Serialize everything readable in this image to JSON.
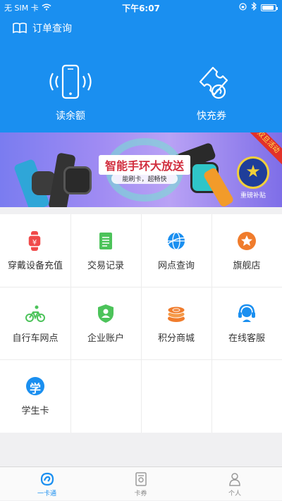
{
  "status_bar": {
    "carrier": "无 SIM 卡",
    "time": "下午6:07",
    "battery_level": 0.9
  },
  "header": {
    "order_query_label": "订单查询",
    "order_query_icon": "book-icon",
    "read_balance_label": "读余额",
    "read_balance_icon": "phone-nfc-icon",
    "quick_recharge_label": "快充券",
    "quick_recharge_icon": "ticket-icon"
  },
  "banner": {
    "title": "智能手环大放送",
    "subtitle": "能刷卡，超畅快",
    "ribbon": "双旦活动",
    "badge_text": "重磅补贴"
  },
  "grid": {
    "items": [
      {
        "label": "穿戴设备充值",
        "icon": "wearable-recharge-icon",
        "color": "#f04a4a"
      },
      {
        "label": "交易记录",
        "icon": "notepad-icon",
        "color": "#4cc35a"
      },
      {
        "label": "网点查询",
        "icon": "globe-icon",
        "color": "#1a8ff0"
      },
      {
        "label": "旗舰店",
        "icon": "star-badge-icon",
        "color": "#f07c2c"
      },
      {
        "label": "自行车网点",
        "icon": "bicycle-icon",
        "color": "#4cc35a"
      },
      {
        "label": "企业账户",
        "icon": "shield-user-icon",
        "color": "#4cc35a"
      },
      {
        "label": "积分商城",
        "icon": "coins-icon",
        "color": "#f07c2c"
      },
      {
        "label": "在线客服",
        "icon": "headset-icon",
        "color": "#1a8ff0"
      },
      {
        "label": "学生卡",
        "icon": "student-icon",
        "color": "#1a8ff0",
        "glyph": "学"
      }
    ]
  },
  "tabbar": {
    "tabs": [
      {
        "label": "一卡通",
        "icon": "card-home-icon",
        "active": true
      },
      {
        "label": "卡券",
        "icon": "coupon-icon",
        "active": false
      },
      {
        "label": "个人",
        "icon": "person-icon",
        "active": false
      }
    ]
  },
  "colors": {
    "primary": "#1a8ff0",
    "background": "#f0f0f2"
  }
}
